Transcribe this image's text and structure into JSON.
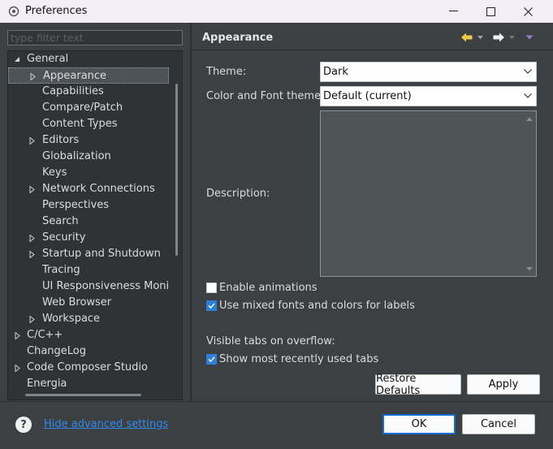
{
  "window": {
    "title": "Preferences",
    "minimize_glyph": "—",
    "maximize_glyph": "□",
    "close_glyph": "✕"
  },
  "filter": {
    "placeholder": "type filter text"
  },
  "tree": {
    "items": [
      {
        "label": "General",
        "level": 0,
        "twisty": "expanded"
      },
      {
        "label": "Appearance",
        "level": 1,
        "twisty": "collapsed",
        "selected": true
      },
      {
        "label": "Capabilities",
        "level": 1,
        "twisty": "none"
      },
      {
        "label": "Compare/Patch",
        "level": 1,
        "twisty": "none"
      },
      {
        "label": "Content Types",
        "level": 1,
        "twisty": "none"
      },
      {
        "label": "Editors",
        "level": 1,
        "twisty": "collapsed"
      },
      {
        "label": "Globalization",
        "level": 1,
        "twisty": "none"
      },
      {
        "label": "Keys",
        "level": 1,
        "twisty": "none"
      },
      {
        "label": "Network Connections",
        "level": 1,
        "twisty": "collapsed"
      },
      {
        "label": "Perspectives",
        "level": 1,
        "twisty": "none"
      },
      {
        "label": "Search",
        "level": 1,
        "twisty": "none"
      },
      {
        "label": "Security",
        "level": 1,
        "twisty": "collapsed"
      },
      {
        "label": "Startup and Shutdown",
        "level": 1,
        "twisty": "collapsed"
      },
      {
        "label": "Tracing",
        "level": 1,
        "twisty": "none"
      },
      {
        "label": "UI Responsiveness Monito",
        "level": 1,
        "twisty": "none"
      },
      {
        "label": "Web Browser",
        "level": 1,
        "twisty": "none"
      },
      {
        "label": "Workspace",
        "level": 1,
        "twisty": "collapsed"
      },
      {
        "label": "C/C++",
        "level": 0,
        "twisty": "collapsed"
      },
      {
        "label": "ChangeLog",
        "level": 0,
        "twisty": "none"
      },
      {
        "label": "Code Composer Studio",
        "level": 0,
        "twisty": "collapsed"
      },
      {
        "label": "Energia",
        "level": 0,
        "twisty": "none"
      }
    ]
  },
  "page": {
    "title": "Appearance",
    "theme_label": "Theme:",
    "theme_value": "Dark",
    "color_font_label": "Color and Font theme:",
    "color_font_value": "Default (current)",
    "description_label": "Description:",
    "description_text": "",
    "enable_animations": {
      "label": "Enable animations",
      "checked": false
    },
    "mixed_fonts": {
      "label": "Use mixed fonts and colors for labels",
      "checked": true
    },
    "tabs_overflow_label": "Visible tabs on overflow:",
    "recent_tabs": {
      "label": "Show most recently used tabs",
      "checked": true
    },
    "restore_defaults": "Restore Defaults",
    "apply": "Apply"
  },
  "nav": {
    "back_icon": "back-arrow-icon",
    "forward_icon": "forward-arrow-icon",
    "menu_icon": "view-menu-icon"
  },
  "footer": {
    "help_glyph": "?",
    "advanced_link": "Hide advanced settings",
    "ok": "OK",
    "cancel": "Cancel"
  },
  "colors": {
    "background": "#3c4043",
    "tree_background": "#2f3336",
    "accent": "#0f6bd6",
    "link": "#2e8cf0",
    "back_arrow": "#f2c84b"
  }
}
